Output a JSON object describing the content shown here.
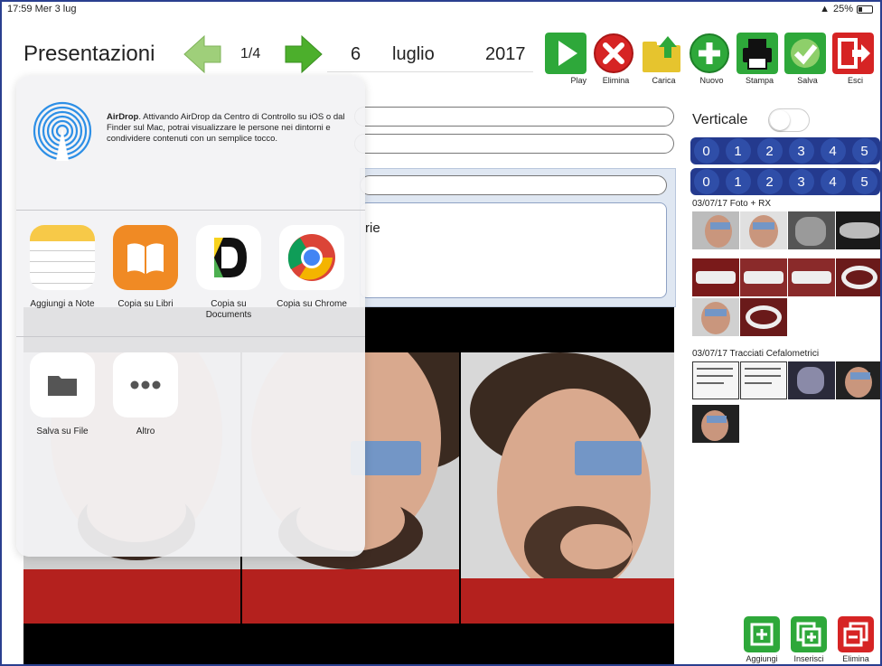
{
  "status": {
    "time": "17:59",
    "date": "Mer 3 lug",
    "battery": "25%"
  },
  "header": {
    "title": "Presentazioni",
    "page_counter": "1/4",
    "date_day": "6",
    "date_month": "luglio",
    "date_year": "2017"
  },
  "toolbar": [
    {
      "label": "Play",
      "icon": "play-icon",
      "color": "#2ea83a"
    },
    {
      "label": "Elimina",
      "icon": "delete-icon",
      "color": "#d62424"
    },
    {
      "label": "Carica",
      "icon": "upload-folder-icon",
      "color": "#e6c42e"
    },
    {
      "label": "Nuovo",
      "icon": "plus-icon",
      "color": "#2ea83a"
    },
    {
      "label": "Stampa",
      "icon": "printer-icon",
      "color": "#2ea83a"
    },
    {
      "label": "Salva",
      "icon": "check-icon",
      "color": "#2ea83a"
    },
    {
      "label": "Esci",
      "icon": "exit-icon",
      "color": "#d62424"
    }
  ],
  "form": {
    "visible_text": "rie"
  },
  "right_panel": {
    "verticale_label": "Verticale",
    "row1": [
      "0",
      "1",
      "2",
      "3",
      "4",
      "5"
    ],
    "row2": [
      "0",
      "1",
      "2",
      "3",
      "4",
      "5"
    ],
    "section1_title": "03/07/17 Foto + RX",
    "section2_title": "03/07/17 Tracciati Cefalometrici"
  },
  "bottom_buttons": [
    {
      "label": "Aggiungi",
      "color": "#2ea83a"
    },
    {
      "label": "Inserisci",
      "color": "#2ea83a"
    },
    {
      "label": "Elimina",
      "color": "#d62424"
    }
  ],
  "share_sheet": {
    "airdrop_title": "AirDrop",
    "airdrop_text": ". Attivando AirDrop da Centro di Controllo su iOS o dal Finder sul Mac, potrai visualizzare le persone nei dintorni e condividere contenuti con un semplice tocco.",
    "apps": [
      {
        "label": "Aggiungi a Note",
        "icon": "notes-icon"
      },
      {
        "label": "Copia su Libri",
        "icon": "books-icon"
      },
      {
        "label": "Copia su Documents",
        "icon": "documents-icon"
      },
      {
        "label": "Copia su Chrome",
        "icon": "chrome-icon"
      }
    ],
    "actions": [
      {
        "label": "Salva su File",
        "icon": "folder-icon"
      },
      {
        "label": "Altro",
        "icon": "more-icon"
      }
    ]
  },
  "colors": {
    "accent_blue": "#243a8e",
    "green": "#2ea83a",
    "red": "#d62424"
  }
}
